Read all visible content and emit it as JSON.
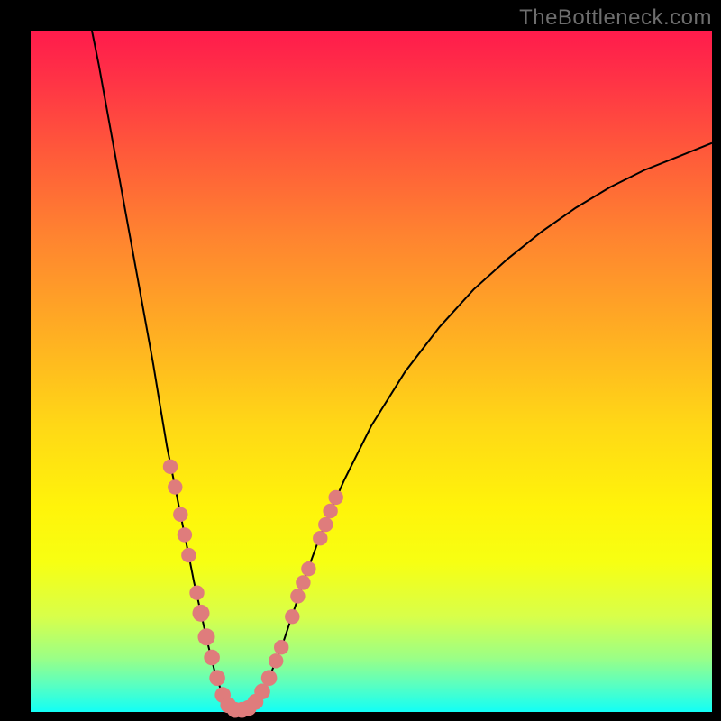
{
  "watermark": "TheBottleneck.com",
  "chart_data": {
    "type": "line",
    "title": "",
    "xlabel": "",
    "ylabel": "",
    "xlim": [
      0,
      100
    ],
    "ylim": [
      0,
      100
    ],
    "curve": [
      {
        "x": 9.0,
        "y": 100.0
      },
      {
        "x": 10.0,
        "y": 95.0
      },
      {
        "x": 12.0,
        "y": 84.0
      },
      {
        "x": 14.0,
        "y": 73.0
      },
      {
        "x": 16.0,
        "y": 62.0
      },
      {
        "x": 18.0,
        "y": 51.0
      },
      {
        "x": 19.0,
        "y": 45.0
      },
      {
        "x": 20.0,
        "y": 39.0
      },
      {
        "x": 21.0,
        "y": 34.0
      },
      {
        "x": 22.0,
        "y": 29.0
      },
      {
        "x": 23.0,
        "y": 24.0
      },
      {
        "x": 24.0,
        "y": 19.0
      },
      {
        "x": 25.0,
        "y": 14.5
      },
      {
        "x": 26.0,
        "y": 10.0
      },
      {
        "x": 27.0,
        "y": 6.0
      },
      {
        "x": 28.0,
        "y": 3.0
      },
      {
        "x": 29.0,
        "y": 1.0
      },
      {
        "x": 30.0,
        "y": 0.3
      },
      {
        "x": 31.0,
        "y": 0.3
      },
      {
        "x": 32.0,
        "y": 0.6
      },
      {
        "x": 33.0,
        "y": 1.5
      },
      {
        "x": 34.0,
        "y": 3.0
      },
      {
        "x": 35.0,
        "y": 5.0
      },
      {
        "x": 36.0,
        "y": 7.5
      },
      {
        "x": 37.0,
        "y": 10.0
      },
      {
        "x": 38.0,
        "y": 13.0
      },
      {
        "x": 40.0,
        "y": 19.0
      },
      {
        "x": 42.0,
        "y": 24.5
      },
      {
        "x": 44.0,
        "y": 29.5
      },
      {
        "x": 46.0,
        "y": 34.0
      },
      {
        "x": 50.0,
        "y": 42.0
      },
      {
        "x": 55.0,
        "y": 50.0
      },
      {
        "x": 60.0,
        "y": 56.5
      },
      {
        "x": 65.0,
        "y": 62.0
      },
      {
        "x": 70.0,
        "y": 66.5
      },
      {
        "x": 75.0,
        "y": 70.5
      },
      {
        "x": 80.0,
        "y": 74.0
      },
      {
        "x": 85.0,
        "y": 77.0
      },
      {
        "x": 90.0,
        "y": 79.5
      },
      {
        "x": 95.0,
        "y": 81.5
      },
      {
        "x": 100.0,
        "y": 83.5
      }
    ],
    "markers": [
      {
        "x": 20.5,
        "y": 36.0,
        "r": 1.2
      },
      {
        "x": 21.2,
        "y": 33.0,
        "r": 1.2
      },
      {
        "x": 22.0,
        "y": 29.0,
        "r": 1.2
      },
      {
        "x": 22.6,
        "y": 26.0,
        "r": 1.2
      },
      {
        "x": 23.2,
        "y": 23.0,
        "r": 1.2
      },
      {
        "x": 24.4,
        "y": 17.5,
        "r": 1.2
      },
      {
        "x": 25.0,
        "y": 14.5,
        "r": 1.4
      },
      {
        "x": 25.8,
        "y": 11.0,
        "r": 1.4
      },
      {
        "x": 26.6,
        "y": 8.0,
        "r": 1.3
      },
      {
        "x": 27.4,
        "y": 5.0,
        "r": 1.3
      },
      {
        "x": 28.2,
        "y": 2.5,
        "r": 1.3
      },
      {
        "x": 29.0,
        "y": 1.0,
        "r": 1.3
      },
      {
        "x": 30.0,
        "y": 0.3,
        "r": 1.3
      },
      {
        "x": 31.0,
        "y": 0.3,
        "r": 1.3
      },
      {
        "x": 32.0,
        "y": 0.6,
        "r": 1.3
      },
      {
        "x": 33.0,
        "y": 1.5,
        "r": 1.3
      },
      {
        "x": 34.0,
        "y": 3.0,
        "r": 1.3
      },
      {
        "x": 35.0,
        "y": 5.0,
        "r": 1.3
      },
      {
        "x": 36.0,
        "y": 7.5,
        "r": 1.2
      },
      {
        "x": 36.8,
        "y": 9.5,
        "r": 1.2
      },
      {
        "x": 38.4,
        "y": 14.0,
        "r": 1.2
      },
      {
        "x": 39.2,
        "y": 17.0,
        "r": 1.2
      },
      {
        "x": 40.0,
        "y": 19.0,
        "r": 1.2
      },
      {
        "x": 40.8,
        "y": 21.0,
        "r": 1.2
      },
      {
        "x": 42.5,
        "y": 25.5,
        "r": 1.2
      },
      {
        "x": 43.3,
        "y": 27.5,
        "r": 1.2
      },
      {
        "x": 44.0,
        "y": 29.5,
        "r": 1.2
      },
      {
        "x": 44.8,
        "y": 31.5,
        "r": 1.2
      }
    ]
  }
}
